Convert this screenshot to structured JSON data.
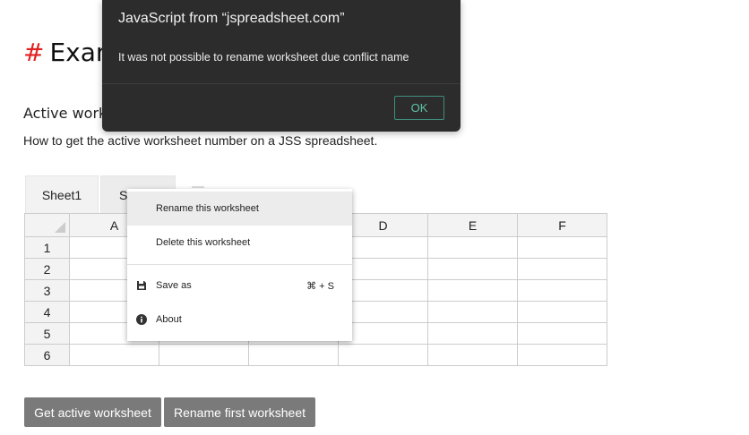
{
  "page": {
    "title_hash": "#",
    "title": "Exam",
    "subtitle": "Active work",
    "description": "How to get the active worksheet number on a JSS spreadsheet."
  },
  "tabs": [
    {
      "label": "Sheet1"
    },
    {
      "label": "S"
    }
  ],
  "grid": {
    "columns": [
      "A",
      "",
      "",
      "D",
      "E",
      "F"
    ],
    "rows": [
      "1",
      "2",
      "3",
      "4",
      "5",
      "6"
    ]
  },
  "buttons": {
    "get_active": "Get active worksheet",
    "rename_first": "Rename first worksheet"
  },
  "context_menu": {
    "rename": "Rename this worksheet",
    "delete": "Delete this worksheet",
    "save_as": "Save as",
    "save_as_shortcut": "⌘ + S",
    "about": "About",
    "save_icon": "floppy-disk-icon",
    "about_icon": "info-icon"
  },
  "dialog": {
    "title": "JavaScript from “jspreadsheet.com”",
    "message": "It was not possible to rename worksheet due conflict name",
    "ok": "OK",
    "ok_color": "#5fc3a8"
  }
}
